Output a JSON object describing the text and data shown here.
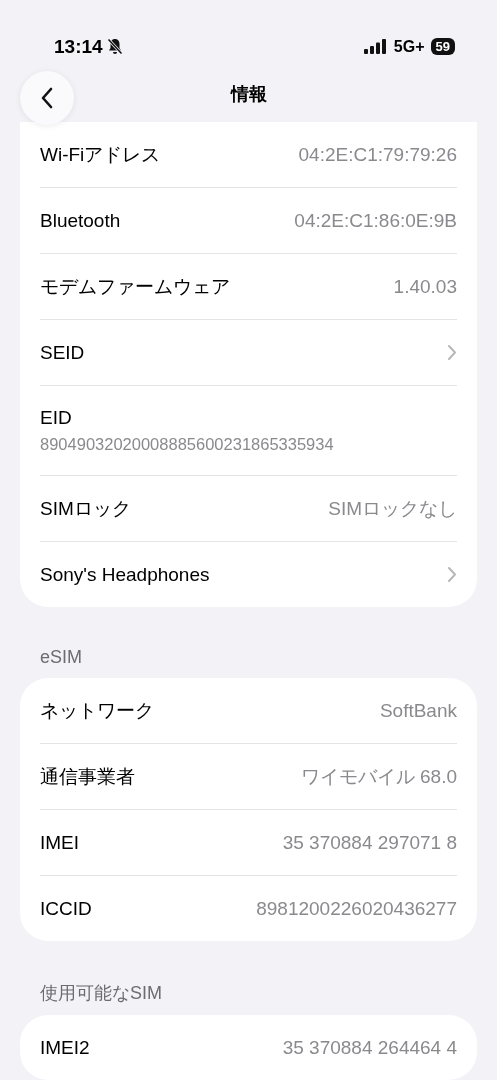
{
  "status_bar": {
    "time": "13:14",
    "network": "5G+",
    "battery": "59"
  },
  "nav": {
    "title": "情報"
  },
  "sections": [
    {
      "rows": [
        {
          "kind": "value",
          "label": "Wi-Fiアドレス",
          "value": "04:2E:C1:79:79:26"
        },
        {
          "kind": "value",
          "label": "Bluetooth",
          "value": "04:2E:C1:86:0E:9B"
        },
        {
          "kind": "value",
          "label": "モデムファームウェア",
          "value": "1.40.03"
        },
        {
          "kind": "link",
          "label": "SEID"
        },
        {
          "kind": "stacked",
          "label": "EID",
          "value": "89049032020008885600231865335934"
        },
        {
          "kind": "value",
          "label": "SIMロック",
          "value": "SIMロックなし"
        },
        {
          "kind": "link",
          "label": "Sony's Headphones"
        }
      ]
    },
    {
      "header": "eSIM",
      "rows": [
        {
          "kind": "value",
          "label": "ネットワーク",
          "value": "SoftBank"
        },
        {
          "kind": "value",
          "label": "通信事業者",
          "value": "ワイモバイル 68.0"
        },
        {
          "kind": "value",
          "label": "IMEI",
          "value": "35 370884 297071 8"
        },
        {
          "kind": "value",
          "label": "ICCID",
          "value": "8981200226020436277"
        }
      ]
    },
    {
      "header": "使用可能なSIM",
      "rows": [
        {
          "kind": "value",
          "label": "IMEI2",
          "value": "35 370884 264464 4"
        }
      ]
    }
  ]
}
